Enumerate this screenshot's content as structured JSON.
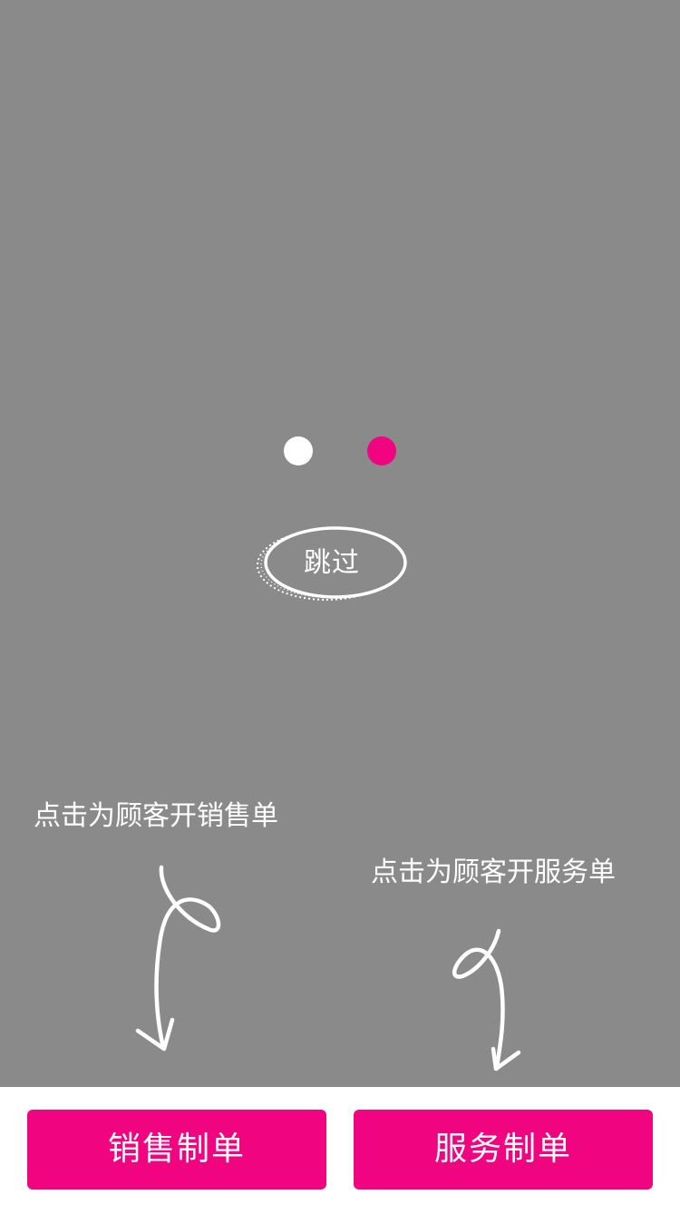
{
  "colors": {
    "overlay": "#8a8a8a",
    "accent": "#f0047f",
    "dot_inactive": "#ffffff",
    "text_light": "#ffffff"
  },
  "guide": {
    "dots": [
      {
        "state": "inactive"
      },
      {
        "state": "active"
      }
    ],
    "skip_label": "跳过",
    "hint_sale": "点击为顾客开销售单",
    "hint_service": "点击为顾客开服务单",
    "arrow_icon": "curly-down-arrow-icon"
  },
  "bottom": {
    "sale_button": "销售制单",
    "service_button": "服务制单"
  }
}
